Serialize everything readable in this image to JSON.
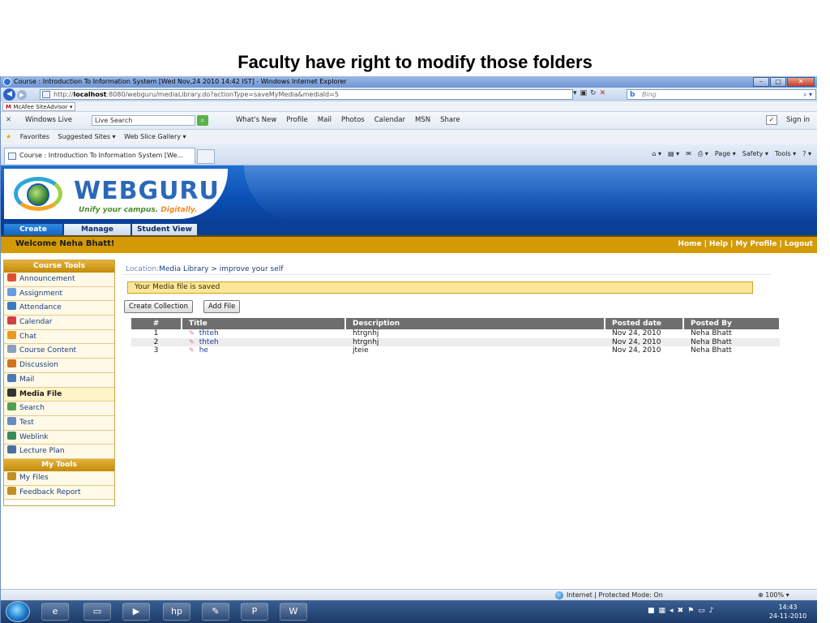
{
  "slide": {
    "title": "Faculty have right to modify those folders"
  },
  "browser": {
    "window_title": "Course : Introduction To Information System [Wed Nov,24 2010 14:42 IST] - Windows Internet Explorer",
    "address": {
      "prefix": "http://",
      "host": "localhost",
      "rest": ":8080/webguru/mediaLibrary.do?actionType=saveMyMedia&mediaId=5"
    },
    "search_placeholder": "Bing",
    "mcafee_label": "McAfee SiteAdvisor",
    "live_toolbar": {
      "brand": "Windows Live",
      "search_value": "Live Search",
      "links": [
        "What's New",
        "Profile",
        "Mail",
        "Photos",
        "Calendar",
        "MSN",
        "Share"
      ],
      "sign_in": "Sign in"
    },
    "favorites": {
      "label": "Favorites",
      "items": [
        "Suggested Sites ▾",
        "Web Slice Gallery ▾"
      ]
    },
    "tab_title": "Course : Introduction To Information System [We...",
    "command_bar": [
      "Page ▾",
      "Safety ▾",
      "Tools ▾"
    ],
    "status": {
      "zone": "Internet | Protected Mode: On",
      "zoom": "100%"
    },
    "clock": {
      "time": "14:43",
      "date": "24-11-2010"
    }
  },
  "app": {
    "logo_text": "WEBGURU",
    "tagline_main": "Unify your campus.",
    "tagline_accent": "Digitally.",
    "nav_tabs": [
      "Create",
      "Manage",
      "Student View"
    ],
    "welcome": "Welcome Neha Bhatt!",
    "top_links": [
      "Home",
      "Help",
      "My Profile",
      "Logout"
    ]
  },
  "sidebar": {
    "course_tools_title": "Course Tools",
    "course_tools": [
      {
        "label": "Announcement",
        "color": "#e05030"
      },
      {
        "label": "Assignment",
        "color": "#6a9be0"
      },
      {
        "label": "Attendance",
        "color": "#3a7ac0"
      },
      {
        "label": "Calendar",
        "color": "#d04040"
      },
      {
        "label": "Chat",
        "color": "#e89a20"
      },
      {
        "label": "Course Content",
        "color": "#8aa0c0"
      },
      {
        "label": "Discussion",
        "color": "#d07020"
      },
      {
        "label": "Mail",
        "color": "#4a7ab0"
      },
      {
        "label": "Media File",
        "color": "#333333"
      },
      {
        "label": "Search",
        "color": "#50a050"
      },
      {
        "label": "Test",
        "color": "#6a8ac0"
      },
      {
        "label": "Weblink",
        "color": "#3a8a5a"
      },
      {
        "label": "Lecture Plan",
        "color": "#4a70a0"
      }
    ],
    "my_tools_title": "My Tools",
    "my_tools": [
      {
        "label": "My Files",
        "color": "#c09020"
      },
      {
        "label": "Feedback Report",
        "color": "#c09020"
      }
    ]
  },
  "content": {
    "location_label": "Location:",
    "location_path": "Media Library > improve your self",
    "saved_message": "Your Media file is saved",
    "buttons": {
      "create_collection": "Create Collection",
      "add_file": "Add File"
    },
    "table": {
      "headers": [
        "#",
        "Title",
        "Description",
        "Posted date",
        "Posted By"
      ],
      "rows": [
        {
          "num": "1",
          "title": "thteh",
          "description": "htrgnhj",
          "date": "Nov 24, 2010",
          "by": "Neha Bhatt"
        },
        {
          "num": "2",
          "title": "thteh",
          "description": "htrgnhj",
          "date": "Nov 24, 2010",
          "by": "Neha Bhatt"
        },
        {
          "num": "3",
          "title": "he",
          "description": "jteie",
          "date": "Nov 24, 2010",
          "by": "Neha Bhatt"
        }
      ]
    }
  }
}
